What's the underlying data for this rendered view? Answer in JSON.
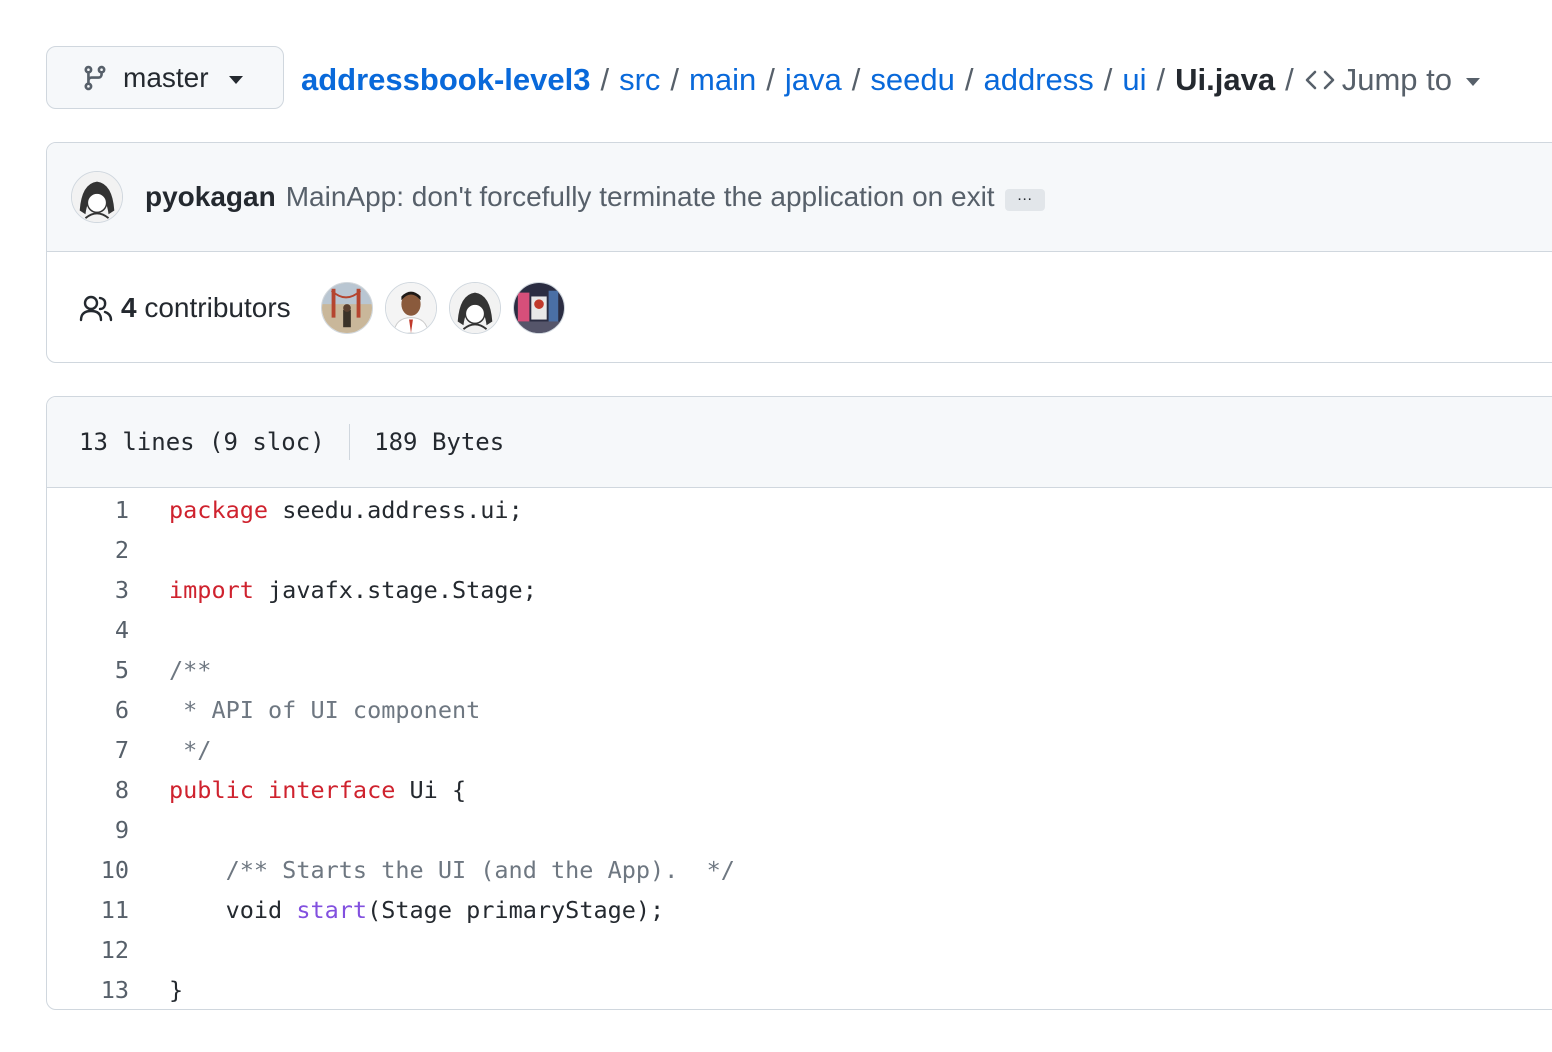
{
  "branch": {
    "name": "master"
  },
  "breadcrumb": {
    "repo": "addressbook-level3",
    "parts": [
      "src",
      "main",
      "java",
      "seedu",
      "address",
      "ui"
    ],
    "current": "Ui.java",
    "separator": "/",
    "jump_label": "Jump to"
  },
  "commit": {
    "author": "pyokagan",
    "message": "MainApp: don't forcefully terminate the application on exit",
    "more_label": "…"
  },
  "contributors": {
    "count": "4",
    "label": "contributors"
  },
  "file_info": {
    "lines": "13 lines (9 sloc)",
    "size": "189 Bytes"
  },
  "code": {
    "line_numbers": [
      "1",
      "2",
      "3",
      "4",
      "5",
      "6",
      "7",
      "8",
      "9",
      "10",
      "11",
      "12",
      "13"
    ],
    "l1_kw": "package",
    "l1_rest": " seedu.address.ui;",
    "l3_kw": "import",
    "l3_rest": " javafx.stage.Stage;",
    "l5": "/**",
    "l6": " * API of UI component",
    "l7": " */",
    "l8_kw1": "public",
    "l8_kw2": "interface",
    "l8_rest": " Ui {",
    "l10": "    /** Starts the UI (and the App).  */",
    "l11_pre": "    void ",
    "l11_fn": "start",
    "l11_rest": "(Stage primaryStage);",
    "l13": "}"
  },
  "colors": {
    "link": "#0969da",
    "keyword": "#cf222e",
    "comment": "#6e7781",
    "function": "#8250df",
    "border": "#d0d7de",
    "header_bg": "#f6f8fa"
  },
  "icons": [
    "git-branch-icon",
    "chevron-down-icon",
    "code-icon",
    "people-icon"
  ]
}
